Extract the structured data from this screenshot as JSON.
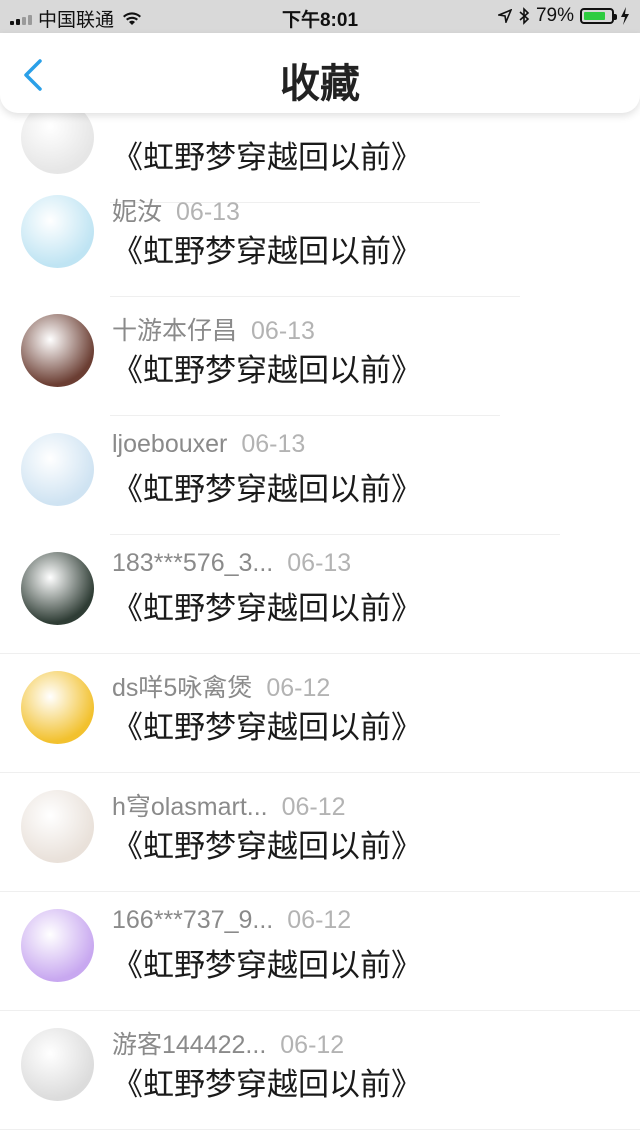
{
  "status_bar": {
    "carrier": "中国联通",
    "time": "下午8:01",
    "battery": "79%",
    "battery_level": 0.79,
    "battery_color": "#2ecc40"
  },
  "header": {
    "title": "收藏"
  },
  "list": {
    "items": [
      {
        "user": "",
        "date": "",
        "title": "《虹野梦穿越回以前》",
        "avatar_color": "#e6e6e6"
      },
      {
        "user": "妮汝",
        "date": "06-13",
        "title": "《虹野梦穿越回以前》",
        "avatar_color": "#bfe4f3"
      },
      {
        "user": "十游本仔昌",
        "date": "06-13",
        "title": "《虹野梦穿越回以前》",
        "avatar_color": "#6b3e33"
      },
      {
        "user": "ljoebouxer",
        "date": "06-13",
        "title": "《虹野梦穿越回以前》",
        "avatar_color": "#cfe3f2"
      },
      {
        "user": "183***576_3...",
        "date": "06-13",
        "title": "《虹野梦穿越回以前》",
        "avatar_color": "#2f3d35"
      },
      {
        "user": "ds咩5咏禽煲",
        "date": "06-12",
        "title": "《虹野梦穿越回以前》",
        "avatar_color": "#f2c12e"
      },
      {
        "user": "h穹olasmart...",
        "date": "06-12",
        "title": "《虹野梦穿越回以前》",
        "avatar_color": "#e9e1da"
      },
      {
        "user": "166***737_9...",
        "date": "06-12",
        "title": "《虹野梦穿越回以前》",
        "avatar_color": "#c8a8f0"
      },
      {
        "user": "游客144422...",
        "date": "06-12",
        "title": "《虹野梦穿越回以前》",
        "avatar_color": "#dcdcdc"
      }
    ]
  }
}
